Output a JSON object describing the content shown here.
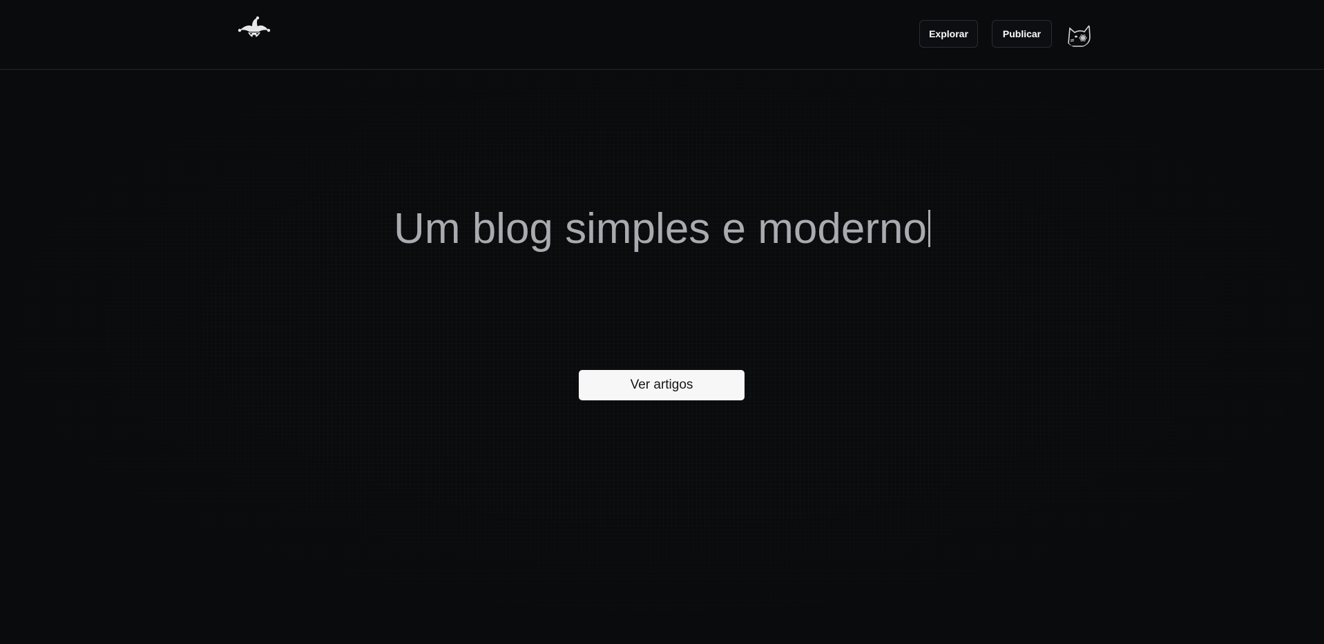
{
  "header": {
    "logo_icon": "jester-hat-logo-icon",
    "nav": {
      "explore_label": "Explorar",
      "publish_label": "Publicar"
    },
    "avatar_icon": "cat-avatar-icon"
  },
  "hero": {
    "title": "Um blog simples e moderno",
    "cta_label": "Ver artigos"
  },
  "colors": {
    "background": "#0a0b0d",
    "title_text": "#a9abb0",
    "cta_background": "#f7f7f7",
    "cta_text": "#141518",
    "border": "#24262b"
  }
}
